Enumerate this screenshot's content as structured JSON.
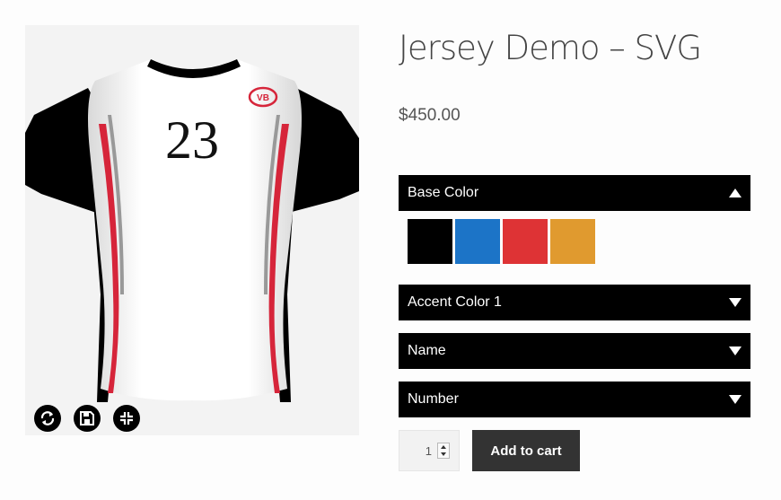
{
  "product": {
    "title": "Jersey Demo – SVG",
    "price": "$450.00"
  },
  "preview": {
    "jersey_number": "23",
    "logo_text": "VB",
    "tools": [
      {
        "name": "reset-icon"
      },
      {
        "name": "save-icon"
      },
      {
        "name": "fullscreen-exit-icon"
      }
    ]
  },
  "options": {
    "base_color": {
      "label": "Base Color",
      "expanded": true,
      "swatches": [
        "#000000",
        "#1c74c7",
        "#de3335",
        "#e09a2f"
      ]
    },
    "accent_color_1": {
      "label": "Accent Color 1",
      "expanded": false
    },
    "name": {
      "label": "Name",
      "expanded": false
    },
    "number": {
      "label": "Number",
      "expanded": false
    }
  },
  "cart": {
    "quantity": "1",
    "button_label": "Add to cart"
  },
  "colors": {
    "accent_stripe": "#d6253a",
    "button_bg": "#333333"
  }
}
